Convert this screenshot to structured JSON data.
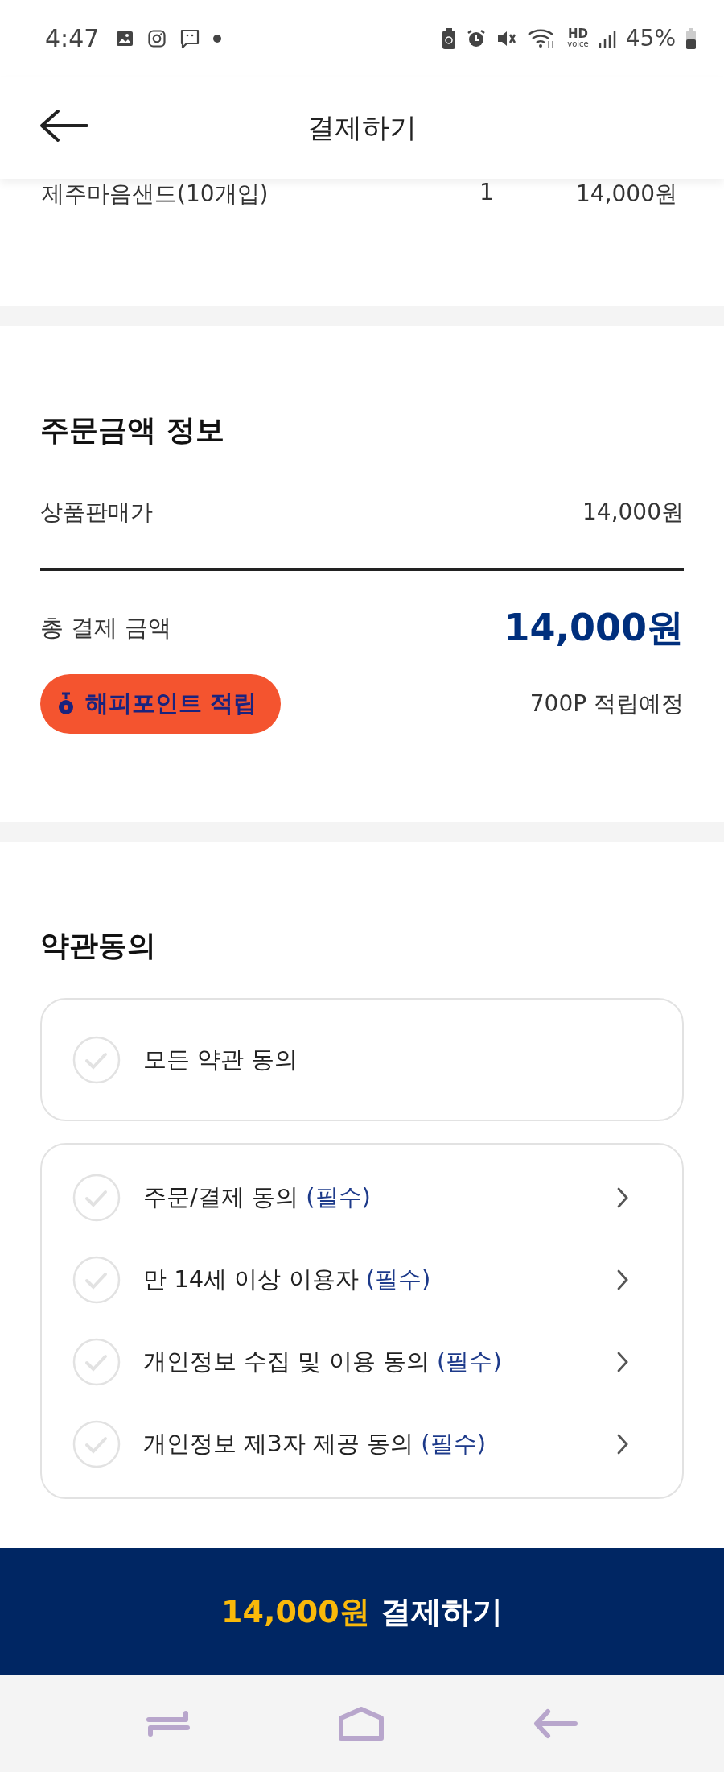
{
  "status_bar": {
    "time": "4:47",
    "battery_text": "45%",
    "hd_label": "HD",
    "voice_label": "voice"
  },
  "header": {
    "title": "결제하기"
  },
  "order_item": {
    "name": "제주마음샌드(10개입)",
    "quantity": "1",
    "price": "14,000원"
  },
  "order_summary": {
    "title": "주문금액 정보",
    "rows": [
      {
        "label": "상품판매가",
        "value": "14,000원"
      }
    ],
    "total": {
      "label": "총 결제 금액",
      "value": "14,000원"
    },
    "points": {
      "badge": "해피포인트 적립",
      "note": "700P 적립예정"
    }
  },
  "terms": {
    "title": "약관동의",
    "all": {
      "label": "모든 약관 동의",
      "checked": false
    },
    "items": [
      {
        "label": "주문/결제 동의",
        "tag": "(필수)",
        "checked": false
      },
      {
        "label": "만 14세 이상 이용자",
        "tag": "(필수)",
        "checked": false
      },
      {
        "label": "개인정보 수집 및 이용 동의",
        "tag": "(필수)",
        "checked": false
      },
      {
        "label": "개인정보 제3자 제공 동의",
        "tag": "(필수)",
        "checked": false
      }
    ]
  },
  "pay_button": {
    "amount": "14,000원",
    "label": "결제하기"
  }
}
